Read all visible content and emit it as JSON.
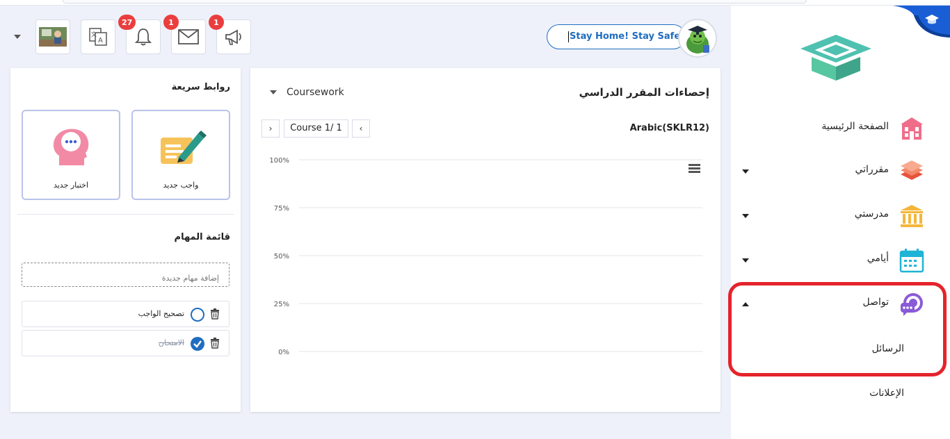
{
  "header": {
    "stay_home_text": "Stay Home! Stay Safe!",
    "badges": {
      "notifications": "27",
      "messages": "1",
      "announcements": "1"
    }
  },
  "sidebar": {
    "items": [
      {
        "label": "الصفحة الرئيسية",
        "icon": "school-building-icon",
        "caret": ""
      },
      {
        "label": "مقرراتي",
        "icon": "layers-icon",
        "caret": "down"
      },
      {
        "label": "مدرستي",
        "icon": "institution-icon",
        "caret": "down"
      },
      {
        "label": "أيامي",
        "icon": "calendar-icon",
        "caret": "down"
      },
      {
        "label": "تواصل",
        "icon": "chat-bubbles-icon",
        "caret": "up"
      }
    ],
    "sub_items": [
      "الرسائل",
      "الإعلانات"
    ]
  },
  "quick_links": {
    "title": "روابط سريعة",
    "new_assignment": "واجب جديد",
    "new_quiz": "اختبار جديد"
  },
  "tasks": {
    "title": "قائمة المهام",
    "input_placeholder": "إضافة مهام جديدة",
    "items": [
      {
        "label": "تصحيح الواجب",
        "done": false
      },
      {
        "label": "الامتحان",
        "done": true
      }
    ]
  },
  "stats": {
    "title": "إحصاءات المقرر الدراسي",
    "dropdown_value": "Coursework",
    "course_name": "Arabic(SKLR12)",
    "pager_label": "Course 1/ 1",
    "prev": "‹",
    "next": "›"
  },
  "chart_data": {
    "type": "bar",
    "title": "",
    "categories": [],
    "values": [],
    "ylim": [
      0,
      100
    ],
    "yticks": [
      "100%",
      "75%",
      "50%",
      "25%",
      "0%"
    ],
    "grid": true
  },
  "colors": {
    "accent": "#1f6dbf",
    "highlight": "#e5232b",
    "badge": "#ea3e3e"
  }
}
